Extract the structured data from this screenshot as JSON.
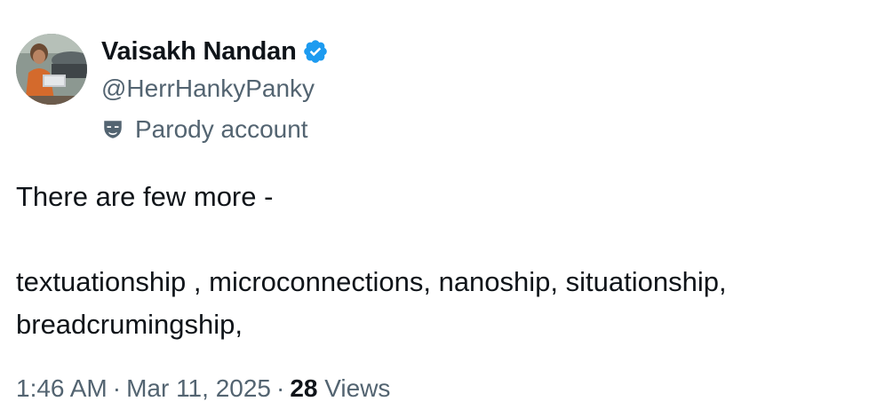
{
  "author": {
    "display_name": "Vaisakh Nandan",
    "handle": "@HerrHankyPanky",
    "label": "Parody account",
    "verified_icon": "verified-badge-icon",
    "label_icon": "parody-mask-icon",
    "verified_color": "#1d9bf0"
  },
  "tweet": {
    "line1": "There are few more -",
    "line2": "textuationship , microconnections, nanoship, situationship,",
    "line3": "breadcrumingship,"
  },
  "meta": {
    "time": "1:46 AM",
    "separator": "·",
    "date": "Mar 11, 2025",
    "views_count": "28",
    "views_label": "Views"
  },
  "colors": {
    "text_primary": "#0f1419",
    "text_secondary": "#536471"
  }
}
